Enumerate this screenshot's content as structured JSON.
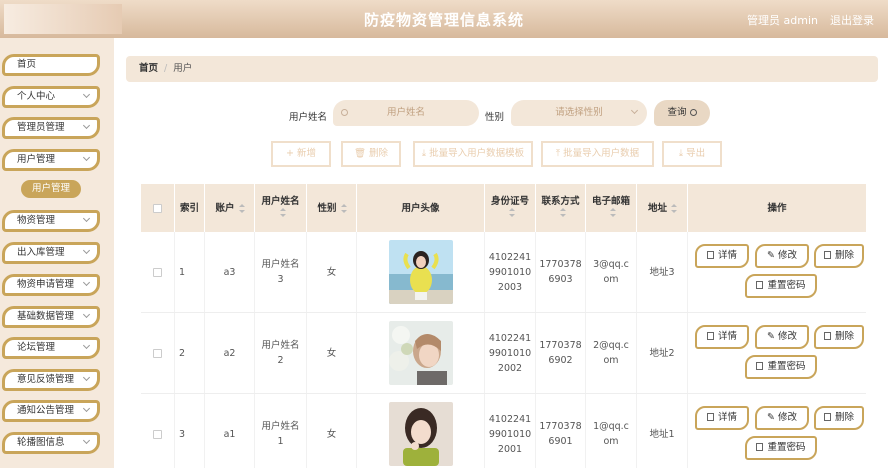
{
  "header": {
    "title": "防疫物资管理信息系统",
    "user_label": "管理员 admin",
    "logout_label": "退出登录"
  },
  "sidebar": {
    "items": [
      {
        "label": "首页",
        "has_arrow": false
      },
      {
        "label": "个人中心",
        "has_arrow": true
      },
      {
        "label": "管理员管理",
        "has_arrow": true
      },
      {
        "label": "用户管理",
        "has_arrow": true
      },
      {
        "label": "物资管理",
        "has_arrow": true
      },
      {
        "label": "出入库管理",
        "has_arrow": true
      },
      {
        "label": "物资申请管理",
        "has_arrow": true
      },
      {
        "label": "基础数据管理",
        "has_arrow": true
      },
      {
        "label": "论坛管理",
        "has_arrow": true
      },
      {
        "label": "意见反馈管理",
        "has_arrow": true
      },
      {
        "label": "通知公告管理",
        "has_arrow": true
      },
      {
        "label": "轮播图信息",
        "has_arrow": true
      }
    ],
    "active_sub": "用户管理"
  },
  "breadcrumb": {
    "home": "首页",
    "sep": "/",
    "current": "用户"
  },
  "search": {
    "name_label": "用户姓名",
    "name_placeholder": "用户姓名",
    "gender_label": "性别",
    "gender_placeholder": "请选择性别",
    "query_label": "查询"
  },
  "toolbar": {
    "add": "+ 新增",
    "delete": "删除",
    "template": "批量导入用户数据模板",
    "import": "批量导入用户数据",
    "export": "导出"
  },
  "table": {
    "headers": {
      "index": "索引",
      "account": "账户",
      "name": "用户姓名",
      "gender": "性别",
      "avatar": "用户头像",
      "id_no": "身份证号",
      "phone": "联系方式",
      "email": "电子邮箱",
      "address": "地址",
      "ops": "操作"
    },
    "rows": [
      {
        "index": "1",
        "account": "a3",
        "name_l1": "用户姓名",
        "name_l2": "3",
        "gender": "女",
        "id_l1": "4102241",
        "id_l2": "9901010",
        "id_l3": "2003",
        "phone_l1": "1770378",
        "phone_l2": "6903",
        "email_l1": "3@qq.c",
        "email_l2": "om",
        "address": "地址3"
      },
      {
        "index": "2",
        "account": "a2",
        "name_l1": "用户姓名",
        "name_l2": "2",
        "gender": "女",
        "id_l1": "4102241",
        "id_l2": "9901010",
        "id_l3": "2002",
        "phone_l1": "1770378",
        "phone_l2": "6902",
        "email_l1": "2@qq.c",
        "email_l2": "om",
        "address": "地址2"
      },
      {
        "index": "3",
        "account": "a1",
        "name_l1": "用户姓名",
        "name_l2": "1",
        "gender": "女",
        "id_l1": "4102241",
        "id_l2": "9901010",
        "id_l3": "2001",
        "phone_l1": "1770378",
        "phone_l2": "6901",
        "email_l1": "1@qq.c",
        "email_l2": "om",
        "address": "地址1"
      }
    ],
    "ops": {
      "detail": "详情",
      "edit": "修改",
      "delete": "删除",
      "reset": "重置密码"
    }
  },
  "colors": {
    "accent": "#c9a55a",
    "panel": "#f3e7d9",
    "header": "#d7b99c"
  }
}
